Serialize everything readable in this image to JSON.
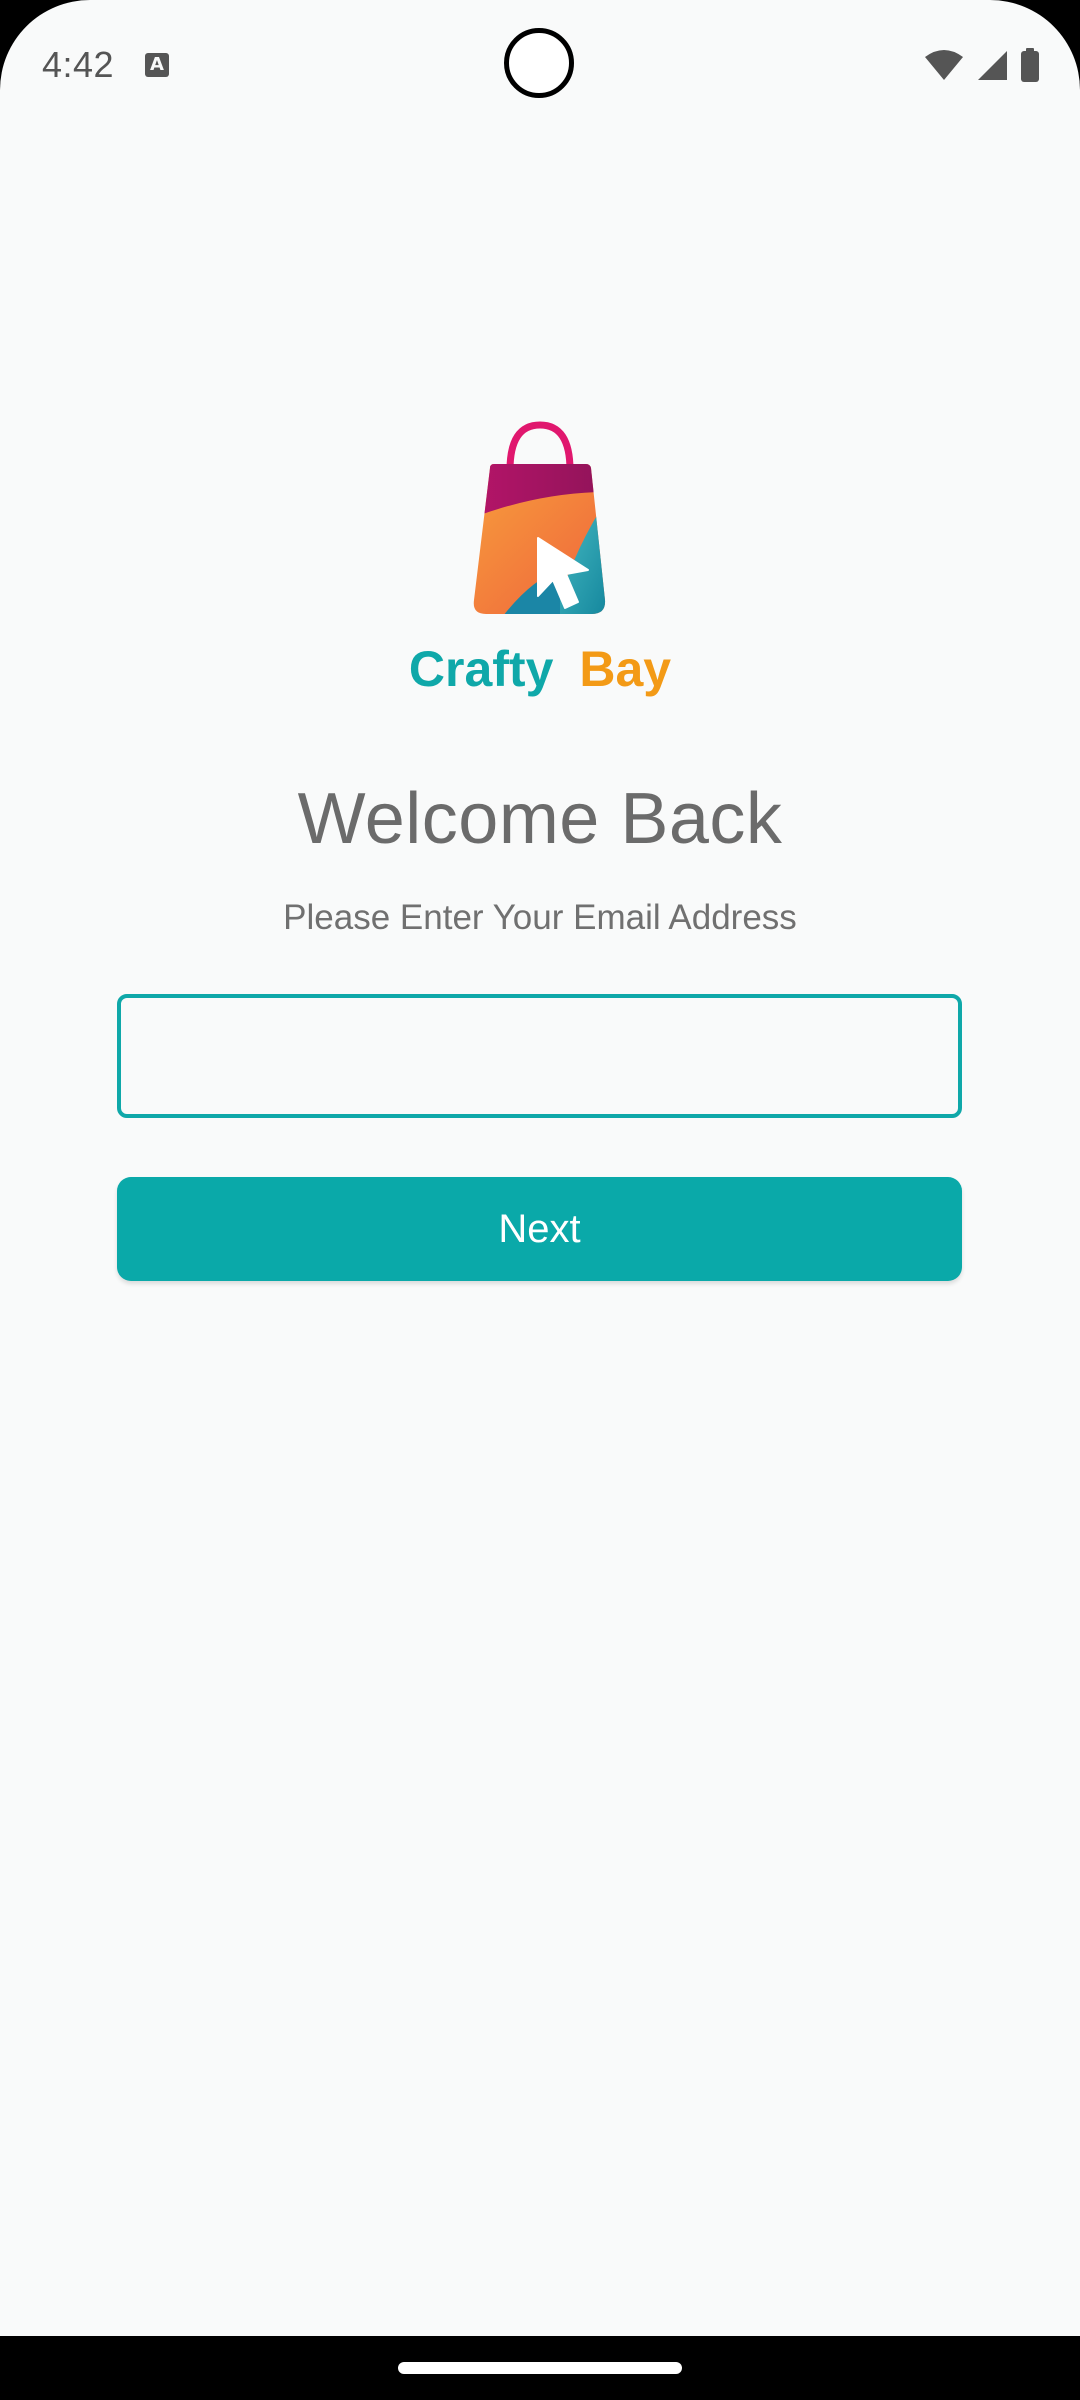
{
  "status_bar": {
    "time": "4:42",
    "notification_icon_letter": "A",
    "icons": [
      "wifi-icon",
      "signal-icon",
      "battery-icon"
    ]
  },
  "brand": {
    "name_part1": "Crafty",
    "name_part2": "Bay",
    "color_part1": "#0fa8a9",
    "color_part2": "#f39a16"
  },
  "login": {
    "title": "Welcome Back",
    "subtitle": "Please Enter Your Email Address",
    "email_value": "",
    "email_placeholder": "",
    "next_label": "Next"
  },
  "colors": {
    "accent": "#0aa9a9",
    "background": "#f9fafa",
    "text_muted": "#6b6b6b"
  }
}
